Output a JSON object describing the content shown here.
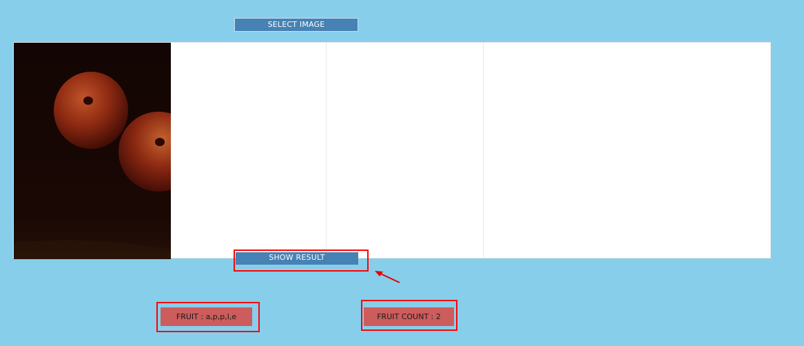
{
  "controls": {
    "select_image_label": "SELECT IMAGE",
    "show_result_label": "SHOW RESULT"
  },
  "results": {
    "fruit": "FRUIT : a,p,p,l,e",
    "fruit_count": "FRUIT COUNT : 2"
  },
  "image_panel": {
    "content": "two red apples on dark background"
  },
  "colors": {
    "background": "#87ceeb",
    "button_blue": "#4682b4",
    "result_red": "#cd5c5c",
    "highlight": "#ff0000"
  }
}
